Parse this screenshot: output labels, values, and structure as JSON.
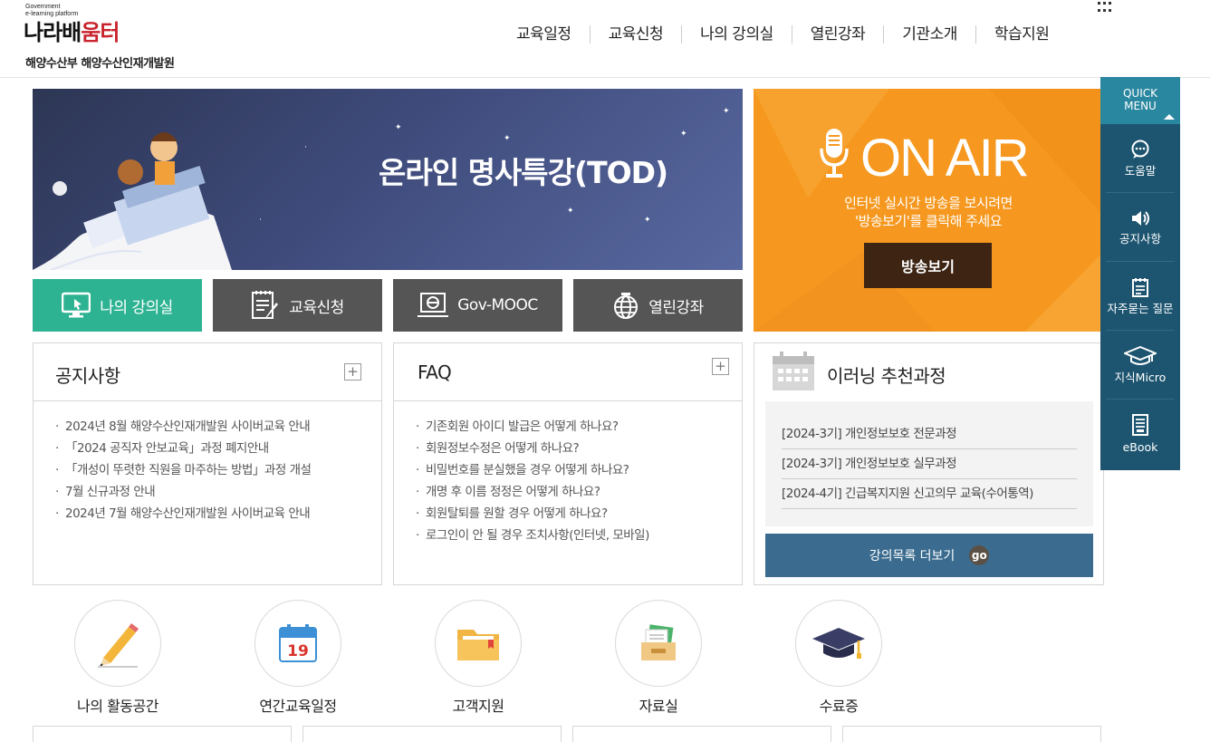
{
  "header": {
    "logo_small_line1": "Government",
    "logo_small_line2": "e-learning platform",
    "logo_main_a": "나라배",
    "logo_main_b": "움터",
    "logo_sub": "해양수산부 해양수산인재개발원",
    "nav": [
      "교육일정",
      "교육신청",
      "나의 강의실",
      "열린강좌",
      "기관소개",
      "학습지원"
    ]
  },
  "banner": {
    "title": "온라인 명사특강(TOD)"
  },
  "quick_buttons": [
    {
      "label": "나의 강의실",
      "icon": "monitor-cursor-icon"
    },
    {
      "label": "교육신청",
      "icon": "document-pen-icon"
    },
    {
      "label": "Gov-MOOC",
      "icon": "laptop-e-icon"
    },
    {
      "label": "열린강좌",
      "icon": "globe-icon"
    }
  ],
  "onair": {
    "title": "ON AIR",
    "desc_line1": "인터넷 실시간 방송을 보시려면",
    "desc_line2": "'방송보기'를 클릭해 주세요",
    "button": "방송보기"
  },
  "notice": {
    "title": "공지사항",
    "items": [
      "2024년 8월 해양수산인재개발원 사이버교육 안내",
      "「2024 공직자 안보교육」과정 폐지안내",
      "「개성이 뚜렷한 직원을 마주하는 방법」과정 개설",
      "7월 신규과정 안내",
      "2024년 7월 해양수산인재개발원 사이버교육 안내"
    ]
  },
  "faq": {
    "title": "FAQ",
    "items": [
      "기존회원 아이디 발급은 어떻게 하나요?",
      "회원정보수정은 어떻게 하나요?",
      "비밀번호를 분실했을 경우 어떻게 하나요?",
      "개명 후 이름 정정은 어떻게 하나요?",
      "회원탈퇴를 원할 경우 어떻게 하나요?",
      "로그인이 안 될 경우 조치사항(인터넷, 모바일)"
    ]
  },
  "recommend": {
    "title": "이러닝 추천과정",
    "items": [
      "[2024-3기] 개인정보보호 전문과정",
      "[2024-3기] 개인정보보호 실무과정",
      "[2024-4기] 긴급복지지원 신고의무 교육(수어통역)"
    ],
    "more": "강의목록 더보기",
    "go": "go"
  },
  "quick_menu": {
    "head_line1": "QUICK",
    "head_line2": "MENU",
    "items": [
      {
        "label": "도움말",
        "icon": "chat-bubble-icon"
      },
      {
        "label": "공지사항",
        "icon": "speaker-icon"
      },
      {
        "label": "자주묻는 질문",
        "icon": "notepad-icon"
      },
      {
        "label": "지식Micro",
        "icon": "graduation-cap-icon"
      },
      {
        "label": "eBook",
        "icon": "ebook-icon"
      }
    ]
  },
  "shortcuts": [
    {
      "label": "나의 활동공간",
      "icon": "pencil-icon"
    },
    {
      "label": "연간교육일정",
      "icon": "calendar-icon",
      "day": "19"
    },
    {
      "label": "고객지원",
      "icon": "folder-icon"
    },
    {
      "label": "자료실",
      "icon": "archive-tray-icon"
    },
    {
      "label": "수료증",
      "icon": "graduation-cap-icon"
    }
  ],
  "colors": {
    "green": "#2eb392",
    "dark_gray": "#555555",
    "onair_orange": "#f6981f",
    "quick_bg": "#1d5570",
    "quick_head": "#2a87a0",
    "more_button": "#3b6c8f"
  }
}
